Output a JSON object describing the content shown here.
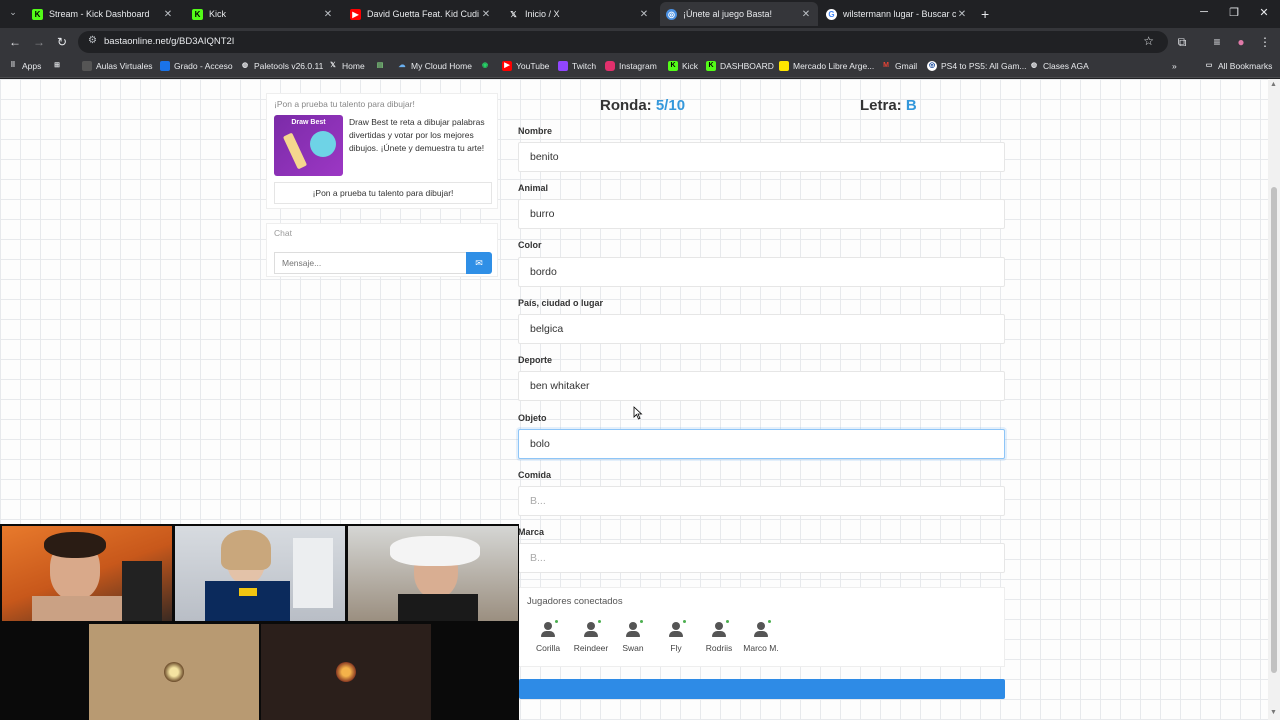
{
  "browser": {
    "tabs": [
      {
        "title": "Stream - Kick Dashboard",
        "favicon": "kick-icon",
        "color": "#53fc18"
      },
      {
        "title": "Kick",
        "favicon": "kick-icon",
        "color": "#53fc18"
      },
      {
        "title": "David Guetta Feat. Kid Cudi",
        "favicon": "youtube-icon",
        "color": "#ff0000"
      },
      {
        "title": "Inicio / X",
        "favicon": "x-icon",
        "color": "#000000"
      },
      {
        "title": "¡Únete al juego Basta!",
        "favicon": "globe-icon",
        "color": "#4a90e2",
        "active": true
      },
      {
        "title": "wilstermann lugar - Buscar con",
        "favicon": "google-icon",
        "color": "#4285f4"
      }
    ],
    "url": "bastaonline.net/g/BD3AIQNT2I",
    "bookmarks": [
      {
        "label": "Apps",
        "icon": "apps-grid-icon"
      },
      {
        "label": "Aulas Virtuales",
        "icon": "bookmark-icon"
      },
      {
        "label": "Grado - Acceso",
        "icon": "bookmark-icon"
      },
      {
        "label": "Paletools v26.0.11",
        "icon": "bookmark-icon"
      },
      {
        "label": "Home",
        "icon": "x-icon"
      },
      {
        "label": "My Cloud Home",
        "icon": "cloud-icon"
      },
      {
        "label": "YouTube",
        "icon": "youtube-icon"
      },
      {
        "label": "Twitch",
        "icon": "twitch-icon"
      },
      {
        "label": "Instagram",
        "icon": "instagram-icon"
      },
      {
        "label": "Kick",
        "icon": "kick-icon"
      },
      {
        "label": "DASHBOARD",
        "icon": "kick-icon"
      },
      {
        "label": "Mercado Libre Arge...",
        "icon": "mercadolibre-icon"
      },
      {
        "label": "Gmail",
        "icon": "gmail-icon"
      },
      {
        "label": "PS4 to PS5: All Gam...",
        "icon": "bookmark-icon"
      },
      {
        "label": "Clases AGA",
        "icon": "bookmark-icon"
      }
    ],
    "all_bookmarks": "All Bookmarks"
  },
  "ad": {
    "title": "¡Pon a prueba tu talento para dibujar!",
    "brand": "Draw Best",
    "text": "Draw Best te reta a dibujar palabras divertidas y votar por los mejores dibujos. ¡Únete y demuestra tu arte!",
    "button": "¡Pon a prueba tu talento para dibujar!"
  },
  "chat": {
    "label": "Chat",
    "placeholder": "Mensaje..."
  },
  "game": {
    "round_label": "Ronda:",
    "round_value": "5/10",
    "letter_label": "Letra:",
    "letter_value": "B"
  },
  "form": {
    "fields": [
      {
        "label": "Nombre",
        "value": "benito",
        "placeholder": "B..."
      },
      {
        "label": "Animal",
        "value": "burro",
        "placeholder": "B..."
      },
      {
        "label": "Color",
        "value": "bordo",
        "placeholder": "B..."
      },
      {
        "label": "País, ciudad o lugar",
        "value": "belgica",
        "placeholder": "B..."
      },
      {
        "label": "Deporte",
        "value": "ben whitaker",
        "placeholder": "B..."
      },
      {
        "label": "Objeto",
        "value": "bolo",
        "placeholder": "B..."
      },
      {
        "label": "Comida",
        "value": "",
        "placeholder": "B..."
      },
      {
        "label": "Marca",
        "value": "",
        "placeholder": "B..."
      }
    ]
  },
  "players": {
    "title": "Jugadores conectados",
    "list": [
      "Corilla",
      "Reindeer",
      "Swan",
      "Fly",
      "Rodriis",
      "Marco M."
    ]
  },
  "colors": {
    "accent": "#2e8be6",
    "highlight": "#3498db",
    "online": "#4caf50"
  }
}
